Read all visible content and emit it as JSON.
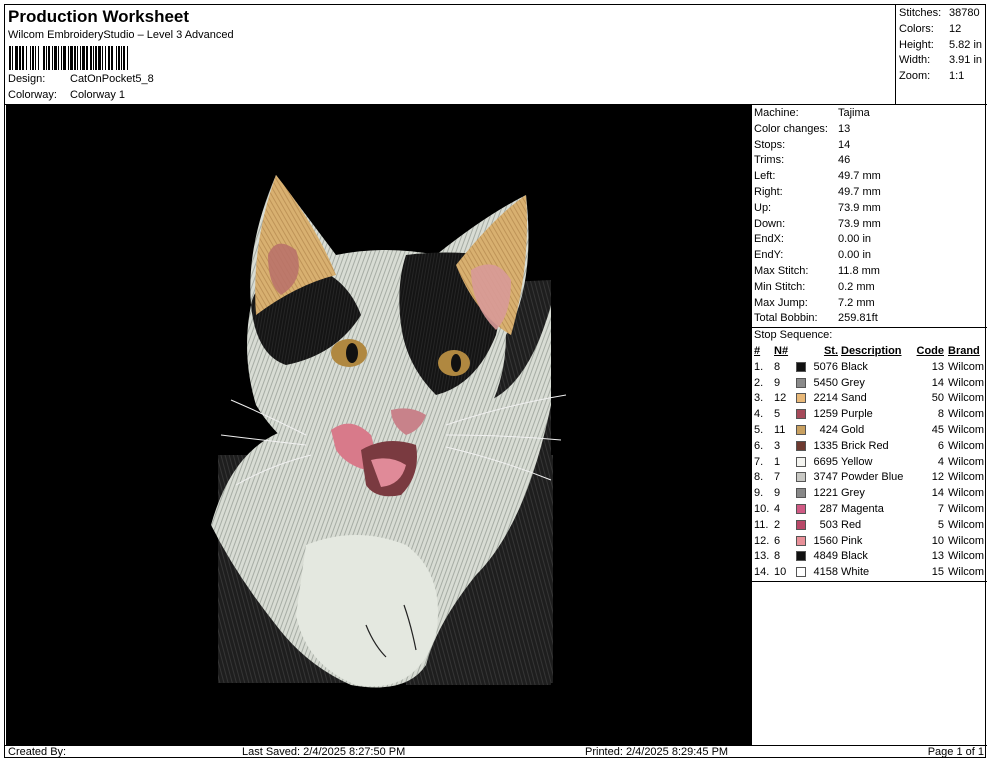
{
  "header": {
    "title": "Production Worksheet",
    "subtitle": "Wilcom EmbroideryStudio – Level 3 Advanced",
    "design_label": "Design:",
    "design_value": "CatOnPocket5_8",
    "colorway_label": "Colorway:",
    "colorway_value": "Colorway 1"
  },
  "stats": [
    {
      "label": "Stitches:",
      "value": "38780"
    },
    {
      "label": "Colors:",
      "value": "12"
    },
    {
      "label": "Height:",
      "value": "5.82 in"
    },
    {
      "label": "Width:",
      "value": "3.91 in"
    },
    {
      "label": "Zoom:",
      "value": "1:1"
    }
  ],
  "info": [
    {
      "label": "Machine:",
      "value": "Tajima"
    },
    {
      "label": "Color changes:",
      "value": "13"
    },
    {
      "label": "Stops:",
      "value": "14"
    },
    {
      "label": "Trims:",
      "value": "46"
    },
    {
      "label": "Left:",
      "value": "49.7 mm"
    },
    {
      "label": "Right:",
      "value": "49.7 mm"
    },
    {
      "label": "Up:",
      "value": "73.9 mm"
    },
    {
      "label": "Down:",
      "value": "73.9 mm"
    },
    {
      "label": "EndX:",
      "value": "0.00 in"
    },
    {
      "label": "EndY:",
      "value": "0.00 in"
    },
    {
      "label": "Max Stitch:",
      "value": "11.8 mm"
    },
    {
      "label": "Min Stitch:",
      "value": "0.2 mm"
    },
    {
      "label": "Max Jump:",
      "value": "7.2 mm"
    },
    {
      "label": "Total Bobbin:",
      "value": "259.81ft"
    }
  ],
  "sequence": {
    "title": "Stop Sequence:",
    "headers": {
      "num": "#",
      "n": "N#",
      "st": "St.",
      "desc": "Description",
      "code": "Code",
      "brand": "Brand"
    },
    "rows": [
      {
        "num": "1.",
        "n": "8",
        "color": "#111111",
        "st": "5076",
        "desc": "Black",
        "code": "13",
        "brand": "Wilcom"
      },
      {
        "num": "2.",
        "n": "9",
        "color": "#8a8a8a",
        "st": "5450",
        "desc": "Grey",
        "code": "14",
        "brand": "Wilcom"
      },
      {
        "num": "3.",
        "n": "12",
        "color": "#e8b878",
        "st": "2214",
        "desc": "Sand",
        "code": "50",
        "brand": "Wilcom"
      },
      {
        "num": "4.",
        "n": "5",
        "color": "#a64a5a",
        "st": "1259",
        "desc": "Purple",
        "code": "8",
        "brand": "Wilcom"
      },
      {
        "num": "5.",
        "n": "11",
        "color": "#c8a060",
        "st": "424",
        "desc": "Gold",
        "code": "45",
        "brand": "Wilcom"
      },
      {
        "num": "6.",
        "n": "3",
        "color": "#6e3a30",
        "st": "1335",
        "desc": "Brick Red",
        "code": "6",
        "brand": "Wilcom"
      },
      {
        "num": "7.",
        "n": "1",
        "color": "#f4f4f0",
        "st": "6695",
        "desc": "Yellow",
        "code": "4",
        "brand": "Wilcom"
      },
      {
        "num": "8.",
        "n": "7",
        "color": "#c8c8c4",
        "st": "3747",
        "desc": "Powder Blue",
        "code": "12",
        "brand": "Wilcom"
      },
      {
        "num": "9.",
        "n": "9",
        "color": "#888888",
        "st": "1221",
        "desc": "Grey",
        "code": "14",
        "brand": "Wilcom"
      },
      {
        "num": "10.",
        "n": "4",
        "color": "#d05a84",
        "st": "287",
        "desc": "Magenta",
        "code": "7",
        "brand": "Wilcom"
      },
      {
        "num": "11.",
        "n": "2",
        "color": "#b84868",
        "st": "503",
        "desc": "Red",
        "code": "5",
        "brand": "Wilcom"
      },
      {
        "num": "12.",
        "n": "6",
        "color": "#e89098",
        "st": "1560",
        "desc": "Pink",
        "code": "10",
        "brand": "Wilcom"
      },
      {
        "num": "13.",
        "n": "8",
        "color": "#111111",
        "st": "4849",
        "desc": "Black",
        "code": "13",
        "brand": "Wilcom"
      },
      {
        "num": "14.",
        "n": "10",
        "color": "#ffffff",
        "st": "4158",
        "desc": "White",
        "code": "15",
        "brand": "Wilcom"
      }
    ]
  },
  "footer": {
    "created_by": "Created By:",
    "last_saved": "Last Saved: 2/4/2025 8:27:50 PM",
    "printed": "Printed: 2/4/2025 8:29:45 PM",
    "page": "Page 1 of 1"
  },
  "icons": {
    "barcode": "barcode-graphic",
    "design_preview": "embroidered-cat-image"
  }
}
